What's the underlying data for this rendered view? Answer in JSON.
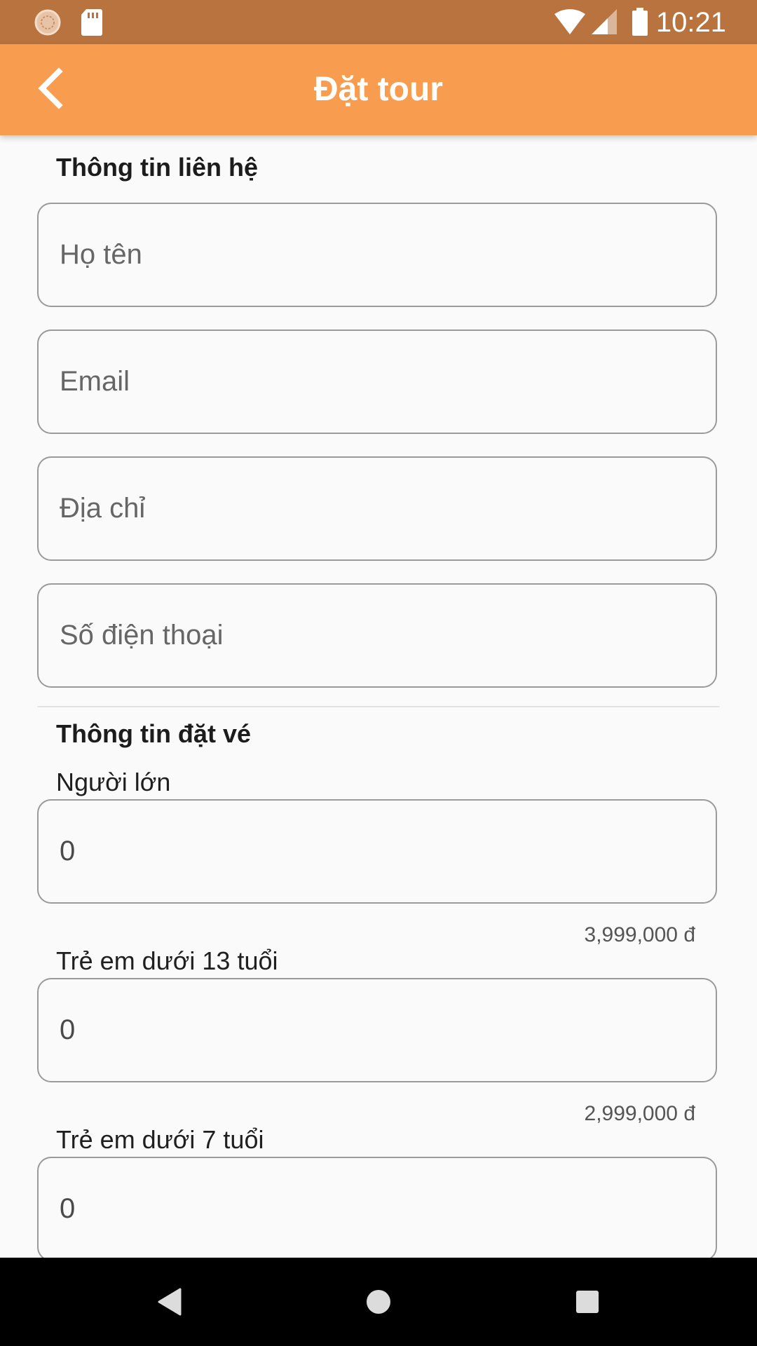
{
  "status_bar": {
    "time": "10:21",
    "icons": [
      "notification-circle-icon",
      "sd-card-icon",
      "wifi-icon",
      "signal-icon",
      "battery-icon"
    ]
  },
  "app_bar": {
    "title": "Đặt tour",
    "back_icon": "chevron-left-icon"
  },
  "contact_section": {
    "title": "Thông tin liên hệ",
    "fields": [
      {
        "placeholder": "Họ tên",
        "value": ""
      },
      {
        "placeholder": "Email",
        "value": ""
      },
      {
        "placeholder": "Địa chỉ",
        "value": ""
      },
      {
        "placeholder": "Số điện thoại",
        "value": ""
      }
    ]
  },
  "booking_section": {
    "title": "Thông tin đặt vé",
    "items": [
      {
        "label": "Người lớn",
        "value": "0",
        "price": "3,999,000 đ"
      },
      {
        "label": "Trẻ em dưới 13 tuổi",
        "value": "0",
        "price": "2,999,000 đ"
      },
      {
        "label": "Trẻ em dưới 7 tuổi",
        "value": "0"
      }
    ]
  },
  "nav_bar": {
    "icons": [
      "back-triangle-icon",
      "home-circle-icon",
      "recents-square-icon"
    ]
  },
  "colors": {
    "status_bar": "#b8733e",
    "app_bar": "#f89c4f",
    "background": "#fafafa",
    "field_border": "#9a9a9a"
  }
}
